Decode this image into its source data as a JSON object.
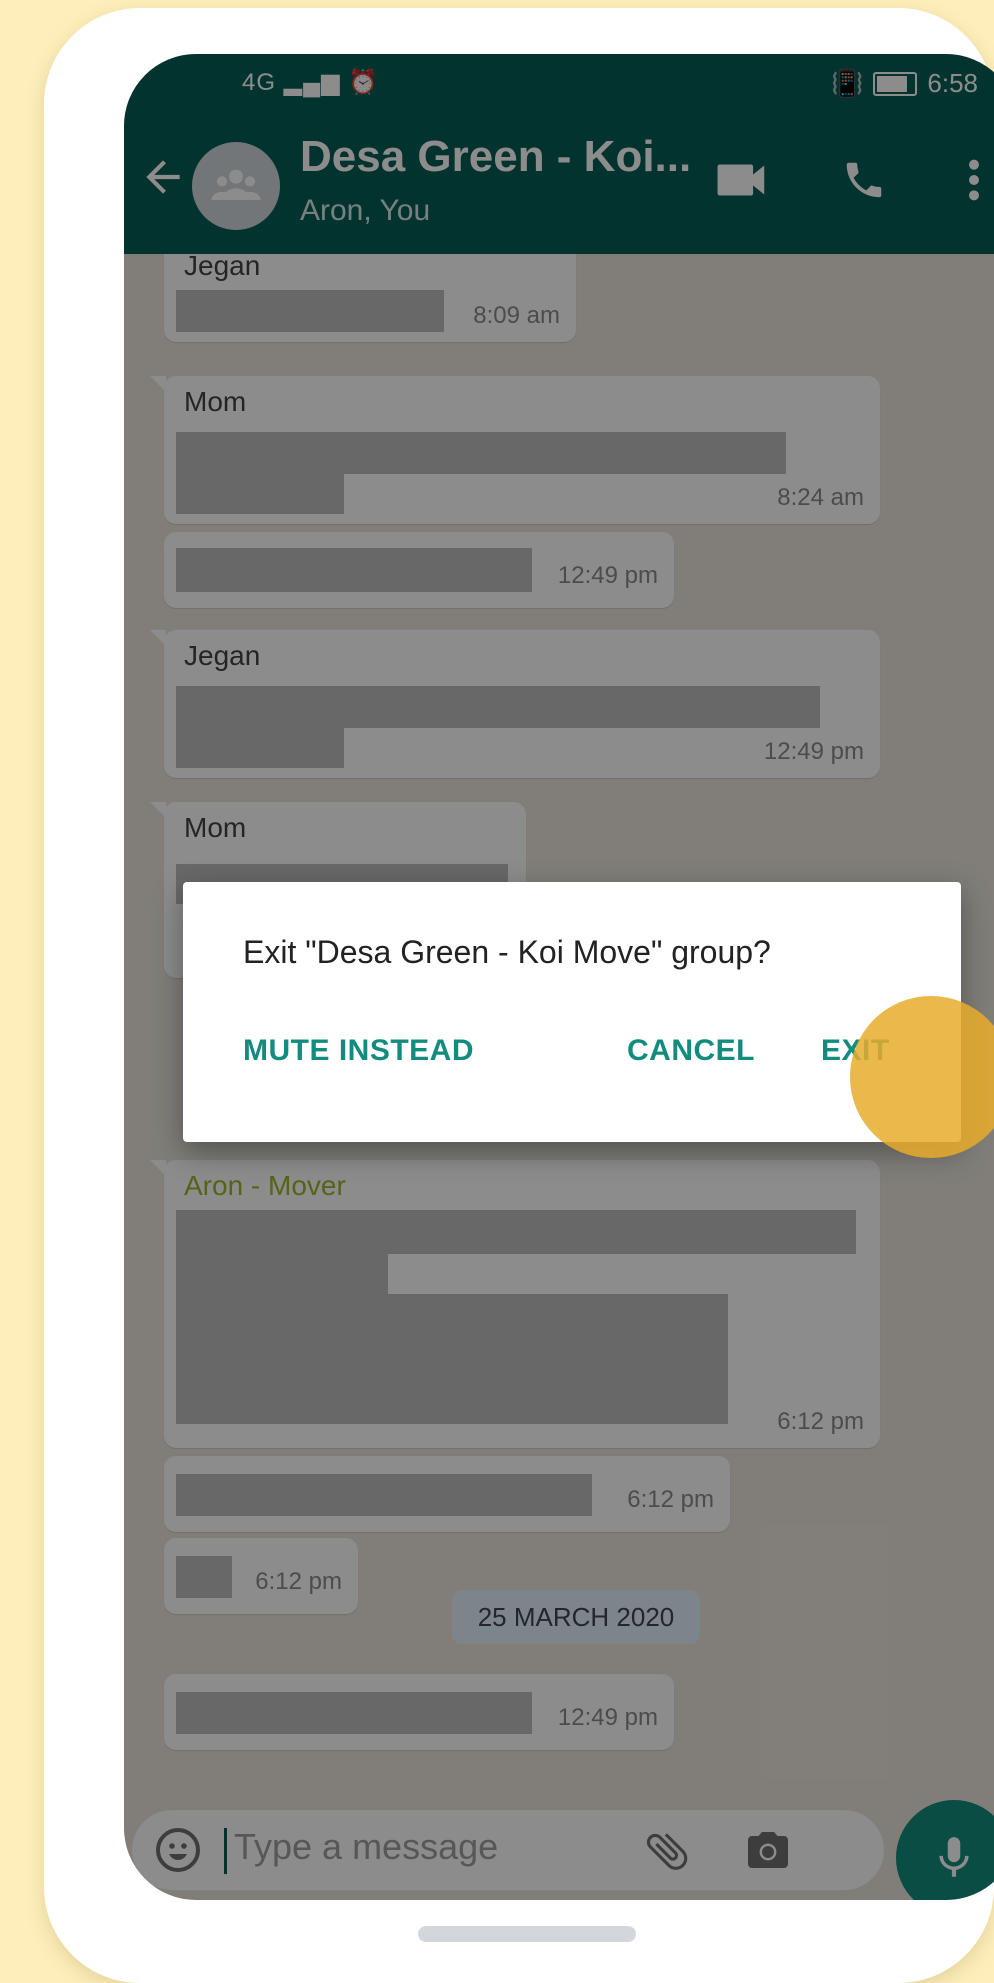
{
  "status_bar": {
    "network": "4G",
    "time": "6:58"
  },
  "app_bar": {
    "title": "Desa Green - Koi...",
    "subtitle": "Aron, You",
    "icons": [
      "back-arrow-icon",
      "group-avatar-icon",
      "video-call-icon",
      "voice-call-icon",
      "more-options-icon"
    ]
  },
  "messages": [
    {
      "sender": "Jegan",
      "time": "8:09 am"
    },
    {
      "sender": "Mom",
      "time": "8:24 am"
    },
    {
      "sender": "",
      "time": "12:49 pm"
    },
    {
      "sender": "Jegan",
      "time": "12:49 pm"
    },
    {
      "sender": "Mom",
      "time": ""
    },
    {
      "sender": "Aron - Mover",
      "time": "6:12 pm"
    },
    {
      "sender": "",
      "time": "6:12 pm"
    },
    {
      "sender": "",
      "time": "6:12 pm"
    },
    {
      "sender": "",
      "time": "12:49 pm"
    }
  ],
  "date_chip": "25 MARCH 2020",
  "input": {
    "placeholder": "Type a message"
  },
  "dialog": {
    "message": "Exit \"Desa Green - Koi Move\" group?",
    "mute_label": "MUTE INSTEAD",
    "cancel_label": "CANCEL",
    "exit_label": "EXIT"
  },
  "colors": {
    "header": "#075e54",
    "accent": "#128c7e",
    "tap_indicator": "#e8ac2c",
    "background": "#fdeebb"
  }
}
